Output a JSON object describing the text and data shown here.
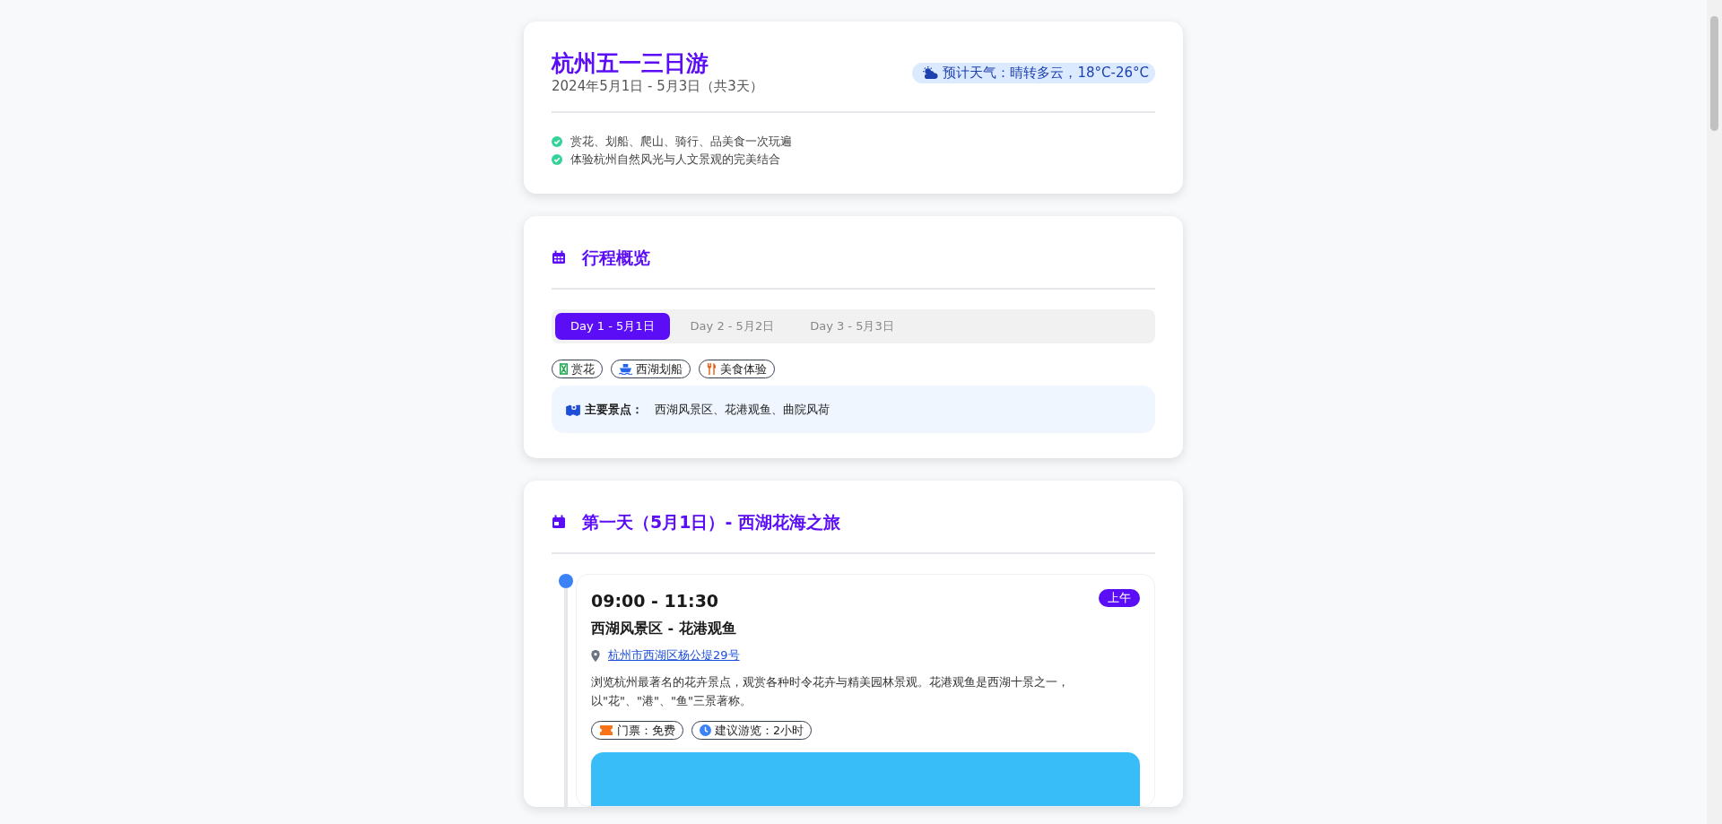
{
  "header": {
    "title": "杭州五一三日游",
    "dates": "2024年5月1日 - 5月3日（共3天）",
    "weather": "预计天气：晴转多云，18°C-26°C",
    "highlights": [
      "赏花、划船、爬山、骑行、品美食一次玩遍",
      "体验杭州自然风光与人文景观的完美结合"
    ]
  },
  "overview": {
    "heading": "行程概览",
    "tabs": [
      {
        "label": "Day 1 - 5月1日",
        "selected": true
      },
      {
        "label": "Day 2 - 5月2日",
        "selected": false
      },
      {
        "label": "Day 3 - 5月3日",
        "selected": false
      }
    ],
    "tags": [
      {
        "label": "赏花",
        "kind": "flower"
      },
      {
        "label": "西湖划船",
        "kind": "boat"
      },
      {
        "label": "美食体验",
        "kind": "food"
      }
    ],
    "main_spots": {
      "label": "主要景点：",
      "value": "西湖风景区、花港观鱼、曲院风荷"
    }
  },
  "day": {
    "heading": "第一天（5月1日）- 西湖花海之旅",
    "events": [
      {
        "time": "09:00 - 11:30",
        "period": "上午",
        "place": "西湖风景区 - 花港观鱼",
        "address": "杭州市西湖区杨公堤29号",
        "description": "浏览杭州最著名的花卉景点，观赏各种时令花卉与精美园林景观。花港观鱼是西湖十景之一，以\"花\"、\"港\"、\"鱼\"三景著称。",
        "tags": [
          {
            "label": "门票：免费",
            "kind": "ticket"
          },
          {
            "label": "建议游览：2小时",
            "kind": "clock"
          }
        ]
      }
    ]
  }
}
